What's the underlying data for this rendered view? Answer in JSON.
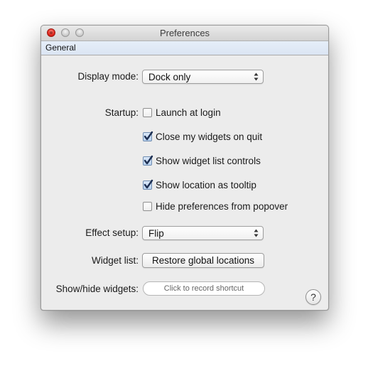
{
  "window": {
    "title": "Preferences"
  },
  "tabs": [
    {
      "label": "General"
    }
  ],
  "settings": {
    "display_mode": {
      "label": "Display mode:",
      "value": "Dock only"
    },
    "startup": {
      "label": "Startup:",
      "options": [
        {
          "label": "Launch at login",
          "checked": false
        },
        {
          "label": "Close my widgets on quit",
          "checked": true
        },
        {
          "label": "Show widget list controls",
          "checked": true
        },
        {
          "label": "Show location as tooltip",
          "checked": true
        },
        {
          "label": "Hide preferences from popover",
          "checked": false
        }
      ]
    },
    "effect_setup": {
      "label": "Effect setup:",
      "value": "Flip"
    },
    "widget_list": {
      "label": "Widget list:",
      "button": "Restore global locations"
    },
    "show_hide": {
      "label": "Show/hide widgets:",
      "placeholder": "Click to record shortcut"
    },
    "help": {
      "label": "?"
    }
  },
  "colors": {
    "checkmark": "#1d2f52",
    "close_button": "#e0251b"
  }
}
